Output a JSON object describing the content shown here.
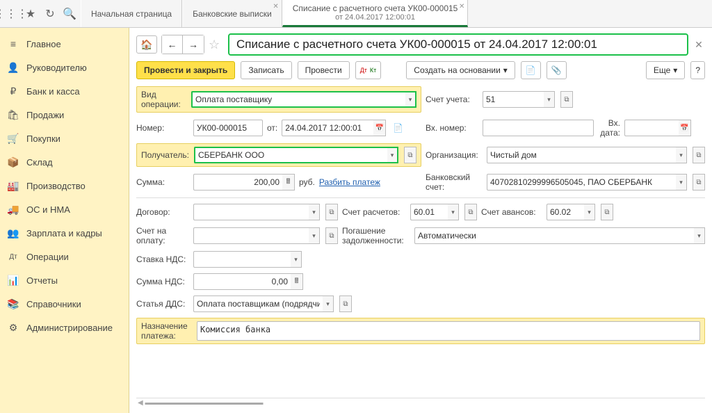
{
  "tabs": {
    "t1": "Начальная страница",
    "t2": "Банковские выписки",
    "t3_line1": "Списание с расчетного счета УК00-000015",
    "t3_line2": "от 24.04.2017 12:00:01"
  },
  "sidebar": [
    {
      "icon": "≡",
      "label": "Главное"
    },
    {
      "icon": "👤",
      "label": "Руководителю"
    },
    {
      "icon": "₽",
      "label": "Банк и касса"
    },
    {
      "icon": "🛍",
      "label": "Продажи"
    },
    {
      "icon": "🛒",
      "label": "Покупки"
    },
    {
      "icon": "📦",
      "label": "Склад"
    },
    {
      "icon": "🏭",
      "label": "Производство"
    },
    {
      "icon": "🚚",
      "label": "ОС и НМА"
    },
    {
      "icon": "👥",
      "label": "Зарплата и кадры"
    },
    {
      "icon": "Дт",
      "label": "Операции"
    },
    {
      "icon": "📊",
      "label": "Отчеты"
    },
    {
      "icon": "📚",
      "label": "Справочники"
    },
    {
      "icon": "⚙",
      "label": "Администрирование"
    }
  ],
  "title": "Списание с расчетного счета УК00-000015 от 24.04.2017 12:00:01",
  "toolbar": {
    "post_close": "Провести и закрыть",
    "write": "Записать",
    "post": "Провести",
    "dtkt": "Дт Кт",
    "create_on_base": "Создать на основании",
    "more": "Еще"
  },
  "form": {
    "op_type_label": "Вид операции:",
    "op_type_value": "Оплата поставщику",
    "account_label": "Счет учета:",
    "account_value": "51",
    "number_label": "Номер:",
    "number_value": "УК00-000015",
    "from_label": "от:",
    "date_value": "24.04.2017 12:00:01",
    "inc_number_label": "Вх. номер:",
    "inc_number_value": "",
    "inc_date_label": "Вх. дата:",
    "inc_date_value": "",
    "recipient_label": "Получатель:",
    "recipient_value": "СБЕРБАНК ООО",
    "org_label": "Организация:",
    "org_value": "Чистый дом",
    "sum_label": "Сумма:",
    "sum_value": "200,00",
    "currency": "руб.",
    "split_label": "Разбить платеж",
    "bank_acc_label": "Банковский счет:",
    "bank_acc_value": "40702810299996505045, ПАО СБЕРБАНК",
    "contract_label": "Договор:",
    "contract_value": "",
    "settle_acc_label": "Счет расчетов:",
    "settle_acc_value": "60.01",
    "advance_acc_label": "Счет авансов:",
    "advance_acc_value": "60.02",
    "invoice_label": "Счет на оплату:",
    "invoice_value": "",
    "debt_label": "Погашение задолженности:",
    "debt_value": "Автоматически",
    "vat_rate_label": "Ставка НДС:",
    "vat_rate_value": "",
    "vat_sum_label": "Сумма НДС:",
    "vat_sum_value": "0,00",
    "dds_label": "Статья ДДС:",
    "dds_value": "Оплата поставщикам (подрядчи",
    "purpose_label": "Назначение платежа:",
    "purpose_value": "Комиссия банка"
  }
}
